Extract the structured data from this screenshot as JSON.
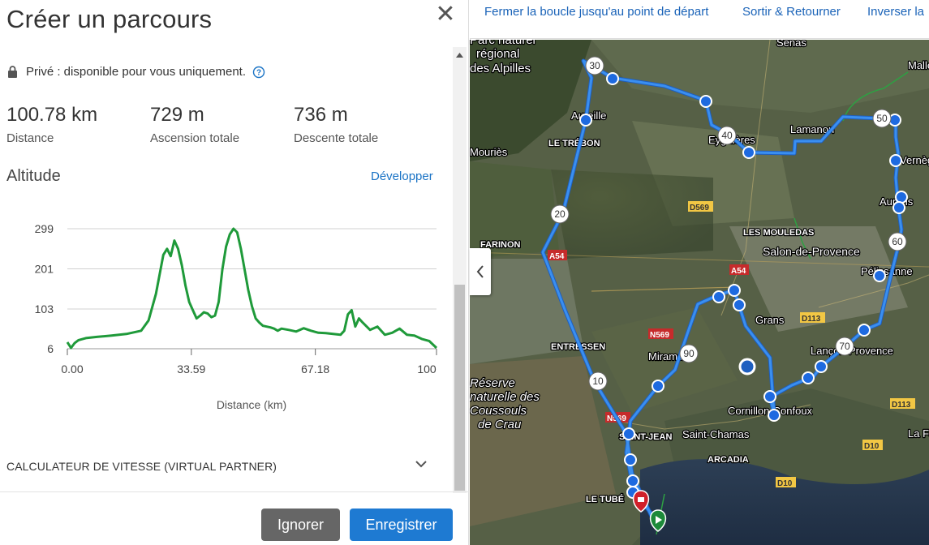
{
  "panel": {
    "title": "Créer un parcours",
    "close_icon": "close-icon",
    "privacy": "Privé : disponible pour vous uniquement.",
    "stats": [
      {
        "value": "100.78 km",
        "label": "Distance"
      },
      {
        "value": "729 m",
        "label": "Ascension totale"
      },
      {
        "value": "736 m",
        "label": "Descente totale"
      }
    ],
    "altitude_title": "Altitude",
    "expand_label": "Développer",
    "speed_calc": "CALCULATEUR DE VITESSE (VIRTUAL PARTNER)",
    "ignore_label": "Ignorer",
    "save_label": "Enregistrer"
  },
  "chart_data": {
    "type": "line",
    "title": "",
    "xlabel": "Distance (km)",
    "ylabel": "",
    "y_ticks": [
      "299",
      "201",
      "103",
      "6"
    ],
    "x_ticks": [
      "0.00",
      "33.59",
      "67.18",
      "100"
    ],
    "ylim": [
      6,
      299
    ],
    "xlim": [
      0,
      100
    ],
    "color": "#1f9a3a",
    "series": [
      {
        "x": [
          0,
          1,
          2,
          3,
          5,
          8,
          12,
          16,
          20,
          22,
          24,
          26,
          27,
          28,
          29,
          30,
          31,
          32,
          33,
          34,
          35,
          36,
          37,
          38,
          39,
          40,
          41,
          42,
          43,
          44,
          45,
          46,
          47,
          48,
          49,
          50,
          51,
          52,
          53,
          54,
          55,
          56,
          57,
          58,
          60,
          62,
          64,
          66,
          68,
          70,
          72,
          74,
          75,
          76,
          77,
          78,
          79,
          80,
          82,
          84,
          86,
          88,
          90,
          92,
          94,
          96,
          98,
          100
        ],
        "y": [
          22,
          8,
          20,
          27,
          32,
          35,
          38,
          42,
          50,
          75,
          140,
          235,
          250,
          232,
          270,
          250,
          210,
          160,
          120,
          100,
          80,
          87,
          95,
          92,
          83,
          87,
          120,
          200,
          255,
          285,
          300,
          290,
          250,
          200,
          150,
          110,
          80,
          70,
          62,
          60,
          58,
          55,
          50,
          55,
          52,
          48,
          56,
          50,
          45,
          44,
          42,
          40,
          50,
          90,
          100,
          60,
          80,
          70,
          52,
          60,
          40,
          45,
          55,
          40,
          38,
          30,
          25,
          8
        ]
      }
    ]
  },
  "map": {
    "links": [
      "Fermer la boucle jusqu'au point de départ",
      "Sortir & Retourner",
      "Inverser la"
    ],
    "collapse_icon": "chevron-left-icon",
    "places": [
      "Senas",
      "Parc naturel",
      "régional",
      "des Alpilles",
      "Aureille",
      "LE TRÉBON",
      "Eyguières",
      "Lamanon",
      "Vernègues",
      "Aurons",
      "Mallemort",
      "FARINON",
      "LES MOULEDAS",
      "Salon-de-Provence",
      "Pélissanne",
      "Grans",
      "Lançon-Provence",
      "ENTRESSEN",
      "Miramas",
      "Réserve",
      "naturelle des",
      "Coussouls",
      "de Crau",
      "Cornillon-Confoux",
      "Saint-Chamas",
      "ARCADIA",
      "SAINT-JEAN",
      "LE TUBÉ",
      "La Fare",
      "Mouriès"
    ],
    "roads": [
      "D569",
      "A54",
      "A54",
      "N569",
      "D113",
      "N569",
      "D10",
      "D10",
      "D113"
    ],
    "km_markers": [
      "10",
      "20",
      "30",
      "40",
      "50",
      "60",
      "70",
      "90"
    ],
    "start_icon": "start-flag-icon",
    "end_icon": "finish-flag-icon"
  }
}
